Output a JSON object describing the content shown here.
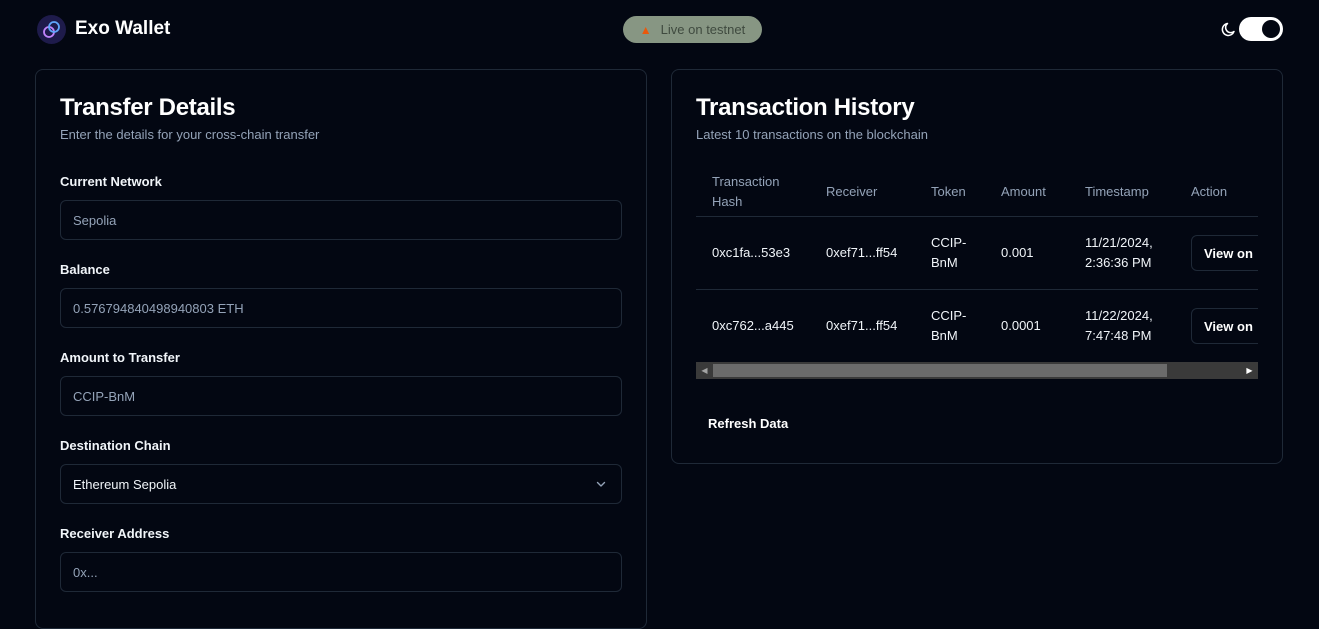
{
  "header": {
    "app_title": "Exo Wallet",
    "logo_icon": "exo-orbit-logo-icon",
    "badge_text": "Live on testnet",
    "badge_icon": "flame-icon",
    "theme_icon": "moon-icon",
    "theme_toggle_on": true
  },
  "transfer": {
    "title": "Transfer Details",
    "subtitle": "Enter the details for your cross-chain transfer",
    "network_label": "Current Network",
    "network_value": "Sepolia",
    "balance_label": "Balance",
    "balance_value": "0.576794840498940803 ETH",
    "amount_label": "Amount to Transfer",
    "amount_placeholder": "CCIP-BnM",
    "destination_label": "Destination Chain",
    "destination_value": "Ethereum Sepolia",
    "receiver_label": "Receiver Address",
    "receiver_placeholder": "0x..."
  },
  "history": {
    "title": "Transaction History",
    "subtitle": "Latest 10 transactions on the blockchain",
    "columns": {
      "hash_line1": "Transaction",
      "hash_line2": "Hash",
      "receiver": "Receiver",
      "token": "Token",
      "amount": "Amount",
      "timestamp": "Timestamp",
      "action": "Action"
    },
    "rows": [
      {
        "hash": "0xc1fa...53e3",
        "receiver": "0xef71...ff54",
        "token_line1": "CCIP-",
        "token_line2": "BnM",
        "amount": "0.001",
        "time_line1": "11/21/2024,",
        "time_line2": "2:36:36 PM",
        "action": "View on"
      },
      {
        "hash": "0xc762...a445",
        "receiver": "0xef71...ff54",
        "token_line1": "CCIP-",
        "token_line2": "BnM",
        "amount": "0.0001",
        "time_line1": "11/22/2024,",
        "time_line2": "7:47:48 PM",
        "action": "View on"
      }
    ],
    "refresh_label": "Refresh Data"
  },
  "colors": {
    "background": "#030712",
    "border": "#1f2937",
    "muted_text": "#94a3b8",
    "badge_bg": "#879683",
    "badge_flame": "#ea580c"
  }
}
